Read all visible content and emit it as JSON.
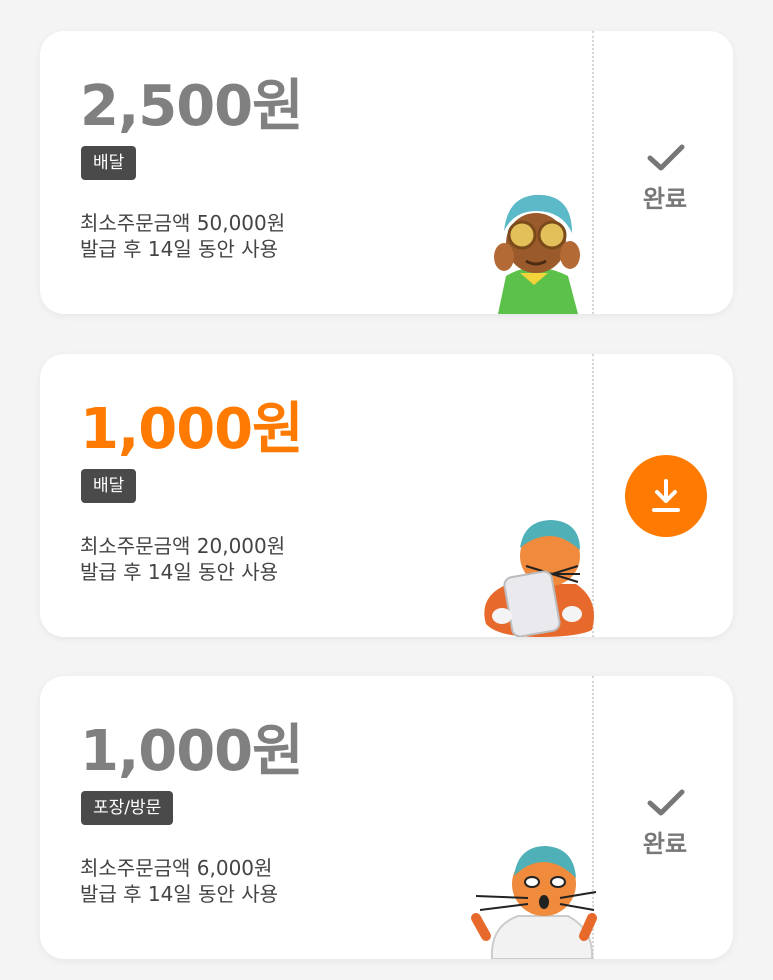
{
  "coupons": [
    {
      "amount": "2,500원",
      "tag": "배달",
      "min_order": "최소주문금액 50,000원",
      "validity": "발급 후 14일 동안 사용",
      "status": "완료",
      "downloaded": true,
      "character_icon": "goggles-character-icon"
    },
    {
      "amount": "1,000원",
      "tag": "배달",
      "min_order": "최소주문금액 20,000원",
      "validity": "발급 후 14일 동안 사용",
      "status": "download",
      "downloaded": false,
      "character_icon": "cat-with-tablet-icon"
    },
    {
      "amount": "1,000원",
      "tag": "포장/방문",
      "min_order": "최소주문금액 6,000원",
      "validity": "발급 후 14일 동안 사용",
      "status": "완료",
      "downloaded": true,
      "character_icon": "surprised-cat-icon"
    }
  ],
  "colors": {
    "accent": "#ff7a00",
    "inactive_amount": "#808080",
    "tag_bg": "#4a4a4a"
  }
}
